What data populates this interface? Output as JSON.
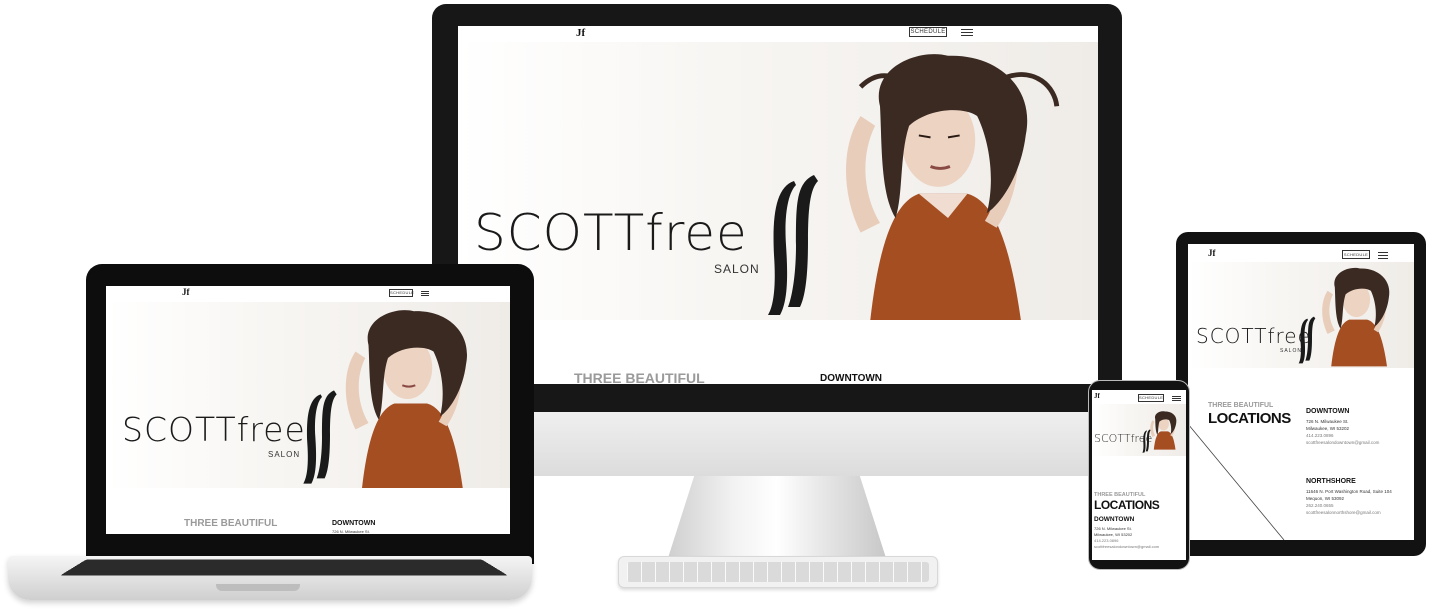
{
  "site": {
    "logo_mark": "Jf",
    "schedule_label": "SCHEDULE",
    "brand_name": "SCOTTfree",
    "brand_sub": "SALON",
    "three_beautiful": "THREE BEAUTIFUL",
    "locations_heading": "LOCATIONS"
  },
  "locations": [
    {
      "name": "DOWNTOWN",
      "address1": "726 N. Milwaukee St.",
      "address2": "Milwaukee, WI 53202",
      "phone": "414.223.0896",
      "email": "scottfreesalondowntown@gmail.com"
    },
    {
      "name": "NORTHSHORE",
      "address1": "11646 N. Port Washington Road, Suite 104",
      "address2": "Mequon, WI 53092",
      "phone": "262.240.0655",
      "email": "scottfreesalonnorthshore@gmail.com"
    }
  ],
  "colors": {
    "dress": "#a44e22",
    "hair": "#3b2a22",
    "device_black": "#151515"
  },
  "icons": {
    "menu": "hamburger-icon"
  }
}
